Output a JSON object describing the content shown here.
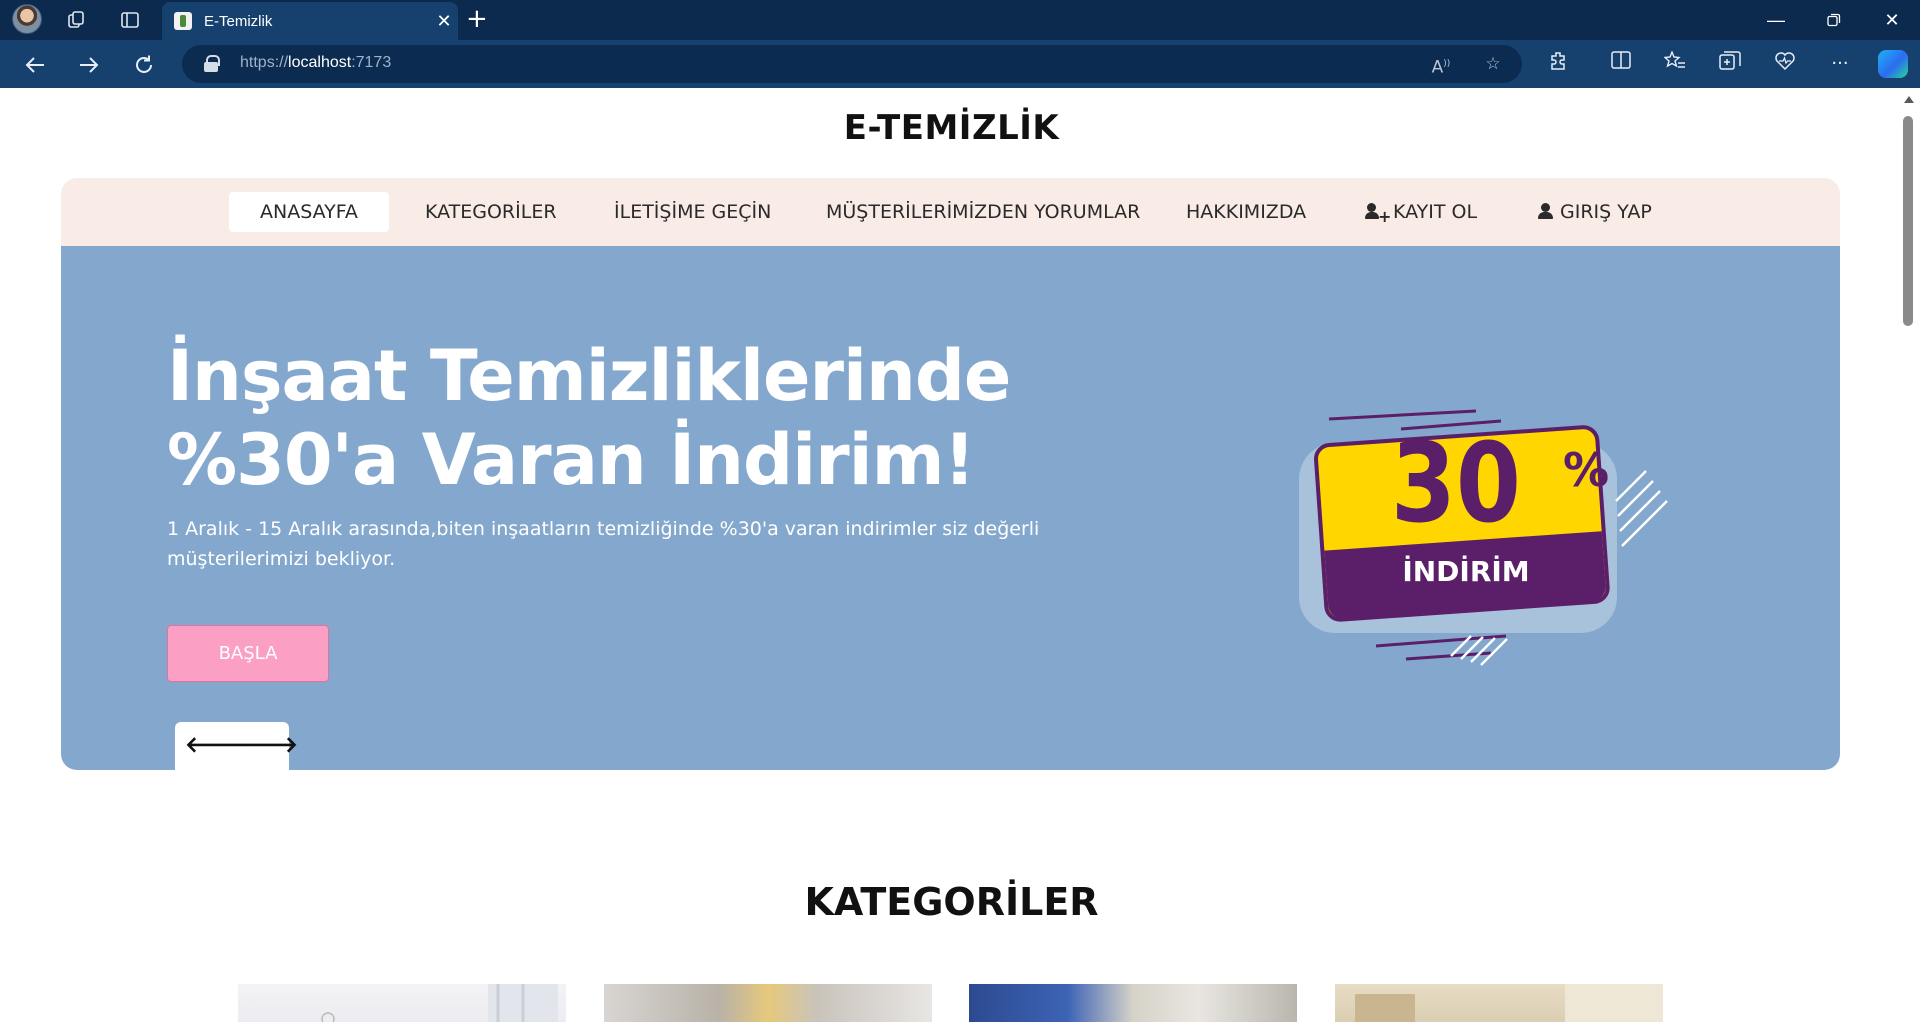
{
  "browser": {
    "tab_title": "E-Temizlik",
    "url_scheme": "https://",
    "url_host": "localhost",
    "url_port": ":7173"
  },
  "site": {
    "brand": "E-TEMİZLİK",
    "nav": {
      "items": [
        {
          "label": "ANASAYFA",
          "active": true
        },
        {
          "label": "KATEGORİLER"
        },
        {
          "label": "İLETİŞİME GEÇİN"
        },
        {
          "label": "MÜŞTERİLERİMİZDEN YORUMLAR"
        },
        {
          "label": "HAKKIMIZDA"
        },
        {
          "label": "KAYIT OL",
          "icon": "user-plus-icon"
        },
        {
          "label": "GIRIŞ YAP",
          "icon": "user-icon"
        }
      ]
    },
    "hero": {
      "title_line1": "İnşaat Temizliklerinde",
      "title_line2": "%30'a Varan İndirim!",
      "text": "1 Aralık - 15 Aralık arasında,biten inşaatların temizliğinde %30'a varan indirimler siz değerli müşterilerimizi bekliyor.",
      "button": "BAŞLA",
      "badge": {
        "number": "30",
        "percent": "%",
        "label": "İNDİRİM"
      }
    },
    "categories": {
      "title": "KATEGORİLER"
    }
  },
  "colors": {
    "hero_bg": "#84a8cd",
    "nav_bg": "#f9ebe6",
    "button_bg": "#fb9fc4",
    "badge_yellow": "#ffd600",
    "badge_purple": "#5a1f68"
  }
}
